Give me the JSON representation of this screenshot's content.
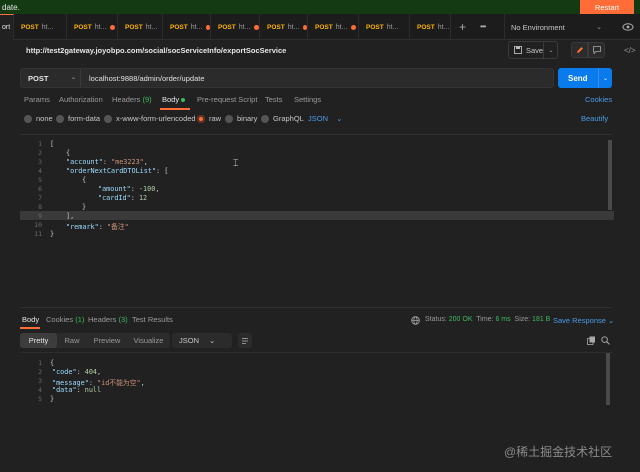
{
  "banner": {
    "text": "date.",
    "restart_label": "Restart"
  },
  "tabs": {
    "first_label": "ort",
    "items": [
      {
        "method": "POST",
        "label": "ht..."
      },
      {
        "method": "POST",
        "label": "ht..."
      },
      {
        "method": "POST",
        "label": "ht..."
      },
      {
        "method": "POST",
        "label": "ht..."
      },
      {
        "method": "POST",
        "label": "ht..."
      },
      {
        "method": "POST",
        "label": "ht..."
      },
      {
        "method": "POST",
        "label": "ht..."
      }
    ],
    "add_label": "+",
    "more_label": "•••",
    "environment": "No Environment"
  },
  "request": {
    "title": "http://test2gateway.joyobpo.com/social/socServiceInfo/exportSocService",
    "save_label": "Save",
    "method": "POST",
    "url": "localhost:9888/admin/order/update",
    "send_label": "Send"
  },
  "req_tabs": {
    "params": "Params",
    "authorization": "Authorization",
    "headers": "Headers",
    "headers_count": "(9)",
    "body": "Body",
    "prerequest": "Pre-request Script",
    "tests": "Tests",
    "settings": "Settings",
    "cookies": "Cookies"
  },
  "body_types": {
    "none": "none",
    "form_data": "form-data",
    "urlencoded": "x-www-form-urlencoded",
    "raw": "raw",
    "binary": "binary",
    "graphql": "GraphQL",
    "format": "JSON",
    "beautify": "Beautify"
  },
  "request_body": {
    "line_numbers": [
      "1",
      "2",
      "3",
      "4",
      "5",
      "6",
      "7",
      "8",
      "9",
      "10",
      "11"
    ],
    "account_key": "\"account\"",
    "account_value": "\"me3223\"",
    "list_key": "\"orderNextCardDTOList\"",
    "amount_key": "\"amount\"",
    "amount_value": "-100",
    "cardid_key": "\"cardId\"",
    "cardid_value": "12",
    "remark_key": "\"remark\"",
    "remark_value": "\"备注\""
  },
  "response": {
    "tabs": {
      "body": "Body",
      "cookies": "Cookies",
      "cookies_count": "(1)",
      "headers": "Headers",
      "headers_count": "(3)",
      "test_results": "Test Results"
    },
    "status_label": "Status:",
    "status_value": "200 OK",
    "time_label": "Time:",
    "time_value": "6 ms",
    "size_label": "Size:",
    "size_value": "181 B",
    "save_response": "Save Response",
    "views": {
      "pretty": "Pretty",
      "raw": "Raw",
      "preview": "Preview",
      "visualize": "Visualize"
    },
    "format": "JSON",
    "line_numbers": [
      "1",
      "2",
      "3",
      "4",
      "5"
    ],
    "code_key": "\"code\"",
    "code_value": "404",
    "message_key": "\"message\"",
    "message_value": "\"id不能为空\"",
    "data_key": "\"data\"",
    "data_value": "null"
  },
  "watermark": "@稀土掘金技术社区",
  "colors": {
    "accent": "#ff6c37",
    "send": "#097bed",
    "link": "#4a9be8",
    "success": "#3dbb61",
    "banner": "#143a14"
  }
}
